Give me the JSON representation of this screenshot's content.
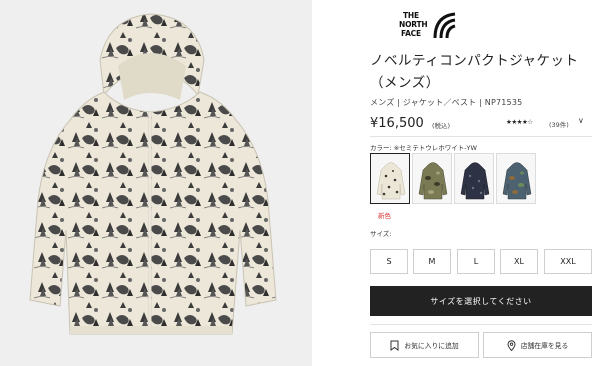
{
  "brand": {
    "logo_lines": [
      "THE",
      "NORTH",
      "FACE"
    ]
  },
  "product": {
    "title_line1": "ノベルティコンパクトジャケット",
    "title_line2": "（メンズ）",
    "meta": "メンズ | ジャケット／ベスト | NP71535",
    "price": "¥16,500",
    "price_tax": "(税込)",
    "rating_stars": "★★★★☆",
    "rating_count": "(39件)",
    "rating_chevron": "∨"
  },
  "color": {
    "label": "カラー: ※セミテトウレホワイト-YW",
    "new_color_label": "新色",
    "swatches": [
      {
        "name": "white-print",
        "fill": "#ece6d6",
        "pattern": "#3a3a3a",
        "selected": true
      },
      {
        "name": "olive-camo",
        "fill": "#7a7a55",
        "pattern": "#3c3b28",
        "selected": false
      },
      {
        "name": "navy-print",
        "fill": "#2d3244",
        "pattern": "#6a7086",
        "selected": false
      },
      {
        "name": "blue-camo",
        "fill": "#4d6270",
        "pattern": "#8c6a3c",
        "selected": false
      }
    ]
  },
  "size": {
    "label": "サイズ:",
    "options": [
      "S",
      "M",
      "L",
      "XL",
      "XXL"
    ]
  },
  "actions": {
    "select_size": "サイズを選択してください",
    "favorite": "お気に入りに追加",
    "store_stock": "店舗在庫を見る"
  },
  "colors": {
    "accent": "#222222",
    "new_label": "#d93535",
    "image_bg": "#efefef"
  }
}
